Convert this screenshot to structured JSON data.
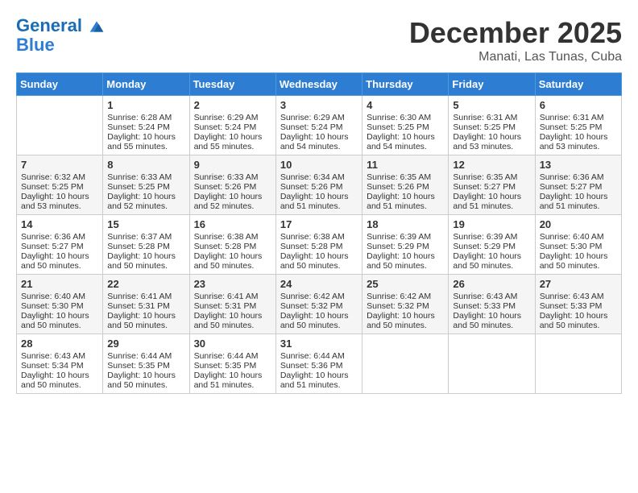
{
  "header": {
    "logo_line1": "General",
    "logo_line2": "Blue",
    "month_title": "December 2025",
    "location": "Manati, Las Tunas, Cuba"
  },
  "days_of_week": [
    "Sunday",
    "Monday",
    "Tuesday",
    "Wednesday",
    "Thursday",
    "Friday",
    "Saturday"
  ],
  "weeks": [
    [
      {
        "day": "",
        "content": ""
      },
      {
        "day": "1",
        "content": "Sunrise: 6:28 AM\nSunset: 5:24 PM\nDaylight: 10 hours\nand 55 minutes."
      },
      {
        "day": "2",
        "content": "Sunrise: 6:29 AM\nSunset: 5:24 PM\nDaylight: 10 hours\nand 55 minutes."
      },
      {
        "day": "3",
        "content": "Sunrise: 6:29 AM\nSunset: 5:24 PM\nDaylight: 10 hours\nand 54 minutes."
      },
      {
        "day": "4",
        "content": "Sunrise: 6:30 AM\nSunset: 5:25 PM\nDaylight: 10 hours\nand 54 minutes."
      },
      {
        "day": "5",
        "content": "Sunrise: 6:31 AM\nSunset: 5:25 PM\nDaylight: 10 hours\nand 53 minutes."
      },
      {
        "day": "6",
        "content": "Sunrise: 6:31 AM\nSunset: 5:25 PM\nDaylight: 10 hours\nand 53 minutes."
      }
    ],
    [
      {
        "day": "7",
        "content": "Sunrise: 6:32 AM\nSunset: 5:25 PM\nDaylight: 10 hours\nand 53 minutes."
      },
      {
        "day": "8",
        "content": "Sunrise: 6:33 AM\nSunset: 5:25 PM\nDaylight: 10 hours\nand 52 minutes."
      },
      {
        "day": "9",
        "content": "Sunrise: 6:33 AM\nSunset: 5:26 PM\nDaylight: 10 hours\nand 52 minutes."
      },
      {
        "day": "10",
        "content": "Sunrise: 6:34 AM\nSunset: 5:26 PM\nDaylight: 10 hours\nand 51 minutes."
      },
      {
        "day": "11",
        "content": "Sunrise: 6:35 AM\nSunset: 5:26 PM\nDaylight: 10 hours\nand 51 minutes."
      },
      {
        "day": "12",
        "content": "Sunrise: 6:35 AM\nSunset: 5:27 PM\nDaylight: 10 hours\nand 51 minutes."
      },
      {
        "day": "13",
        "content": "Sunrise: 6:36 AM\nSunset: 5:27 PM\nDaylight: 10 hours\nand 51 minutes."
      }
    ],
    [
      {
        "day": "14",
        "content": "Sunrise: 6:36 AM\nSunset: 5:27 PM\nDaylight: 10 hours\nand 50 minutes."
      },
      {
        "day": "15",
        "content": "Sunrise: 6:37 AM\nSunset: 5:28 PM\nDaylight: 10 hours\nand 50 minutes."
      },
      {
        "day": "16",
        "content": "Sunrise: 6:38 AM\nSunset: 5:28 PM\nDaylight: 10 hours\nand 50 minutes."
      },
      {
        "day": "17",
        "content": "Sunrise: 6:38 AM\nSunset: 5:28 PM\nDaylight: 10 hours\nand 50 minutes."
      },
      {
        "day": "18",
        "content": "Sunrise: 6:39 AM\nSunset: 5:29 PM\nDaylight: 10 hours\nand 50 minutes."
      },
      {
        "day": "19",
        "content": "Sunrise: 6:39 AM\nSunset: 5:29 PM\nDaylight: 10 hours\nand 50 minutes."
      },
      {
        "day": "20",
        "content": "Sunrise: 6:40 AM\nSunset: 5:30 PM\nDaylight: 10 hours\nand 50 minutes."
      }
    ],
    [
      {
        "day": "21",
        "content": "Sunrise: 6:40 AM\nSunset: 5:30 PM\nDaylight: 10 hours\nand 50 minutes."
      },
      {
        "day": "22",
        "content": "Sunrise: 6:41 AM\nSunset: 5:31 PM\nDaylight: 10 hours\nand 50 minutes."
      },
      {
        "day": "23",
        "content": "Sunrise: 6:41 AM\nSunset: 5:31 PM\nDaylight: 10 hours\nand 50 minutes."
      },
      {
        "day": "24",
        "content": "Sunrise: 6:42 AM\nSunset: 5:32 PM\nDaylight: 10 hours\nand 50 minutes."
      },
      {
        "day": "25",
        "content": "Sunrise: 6:42 AM\nSunset: 5:32 PM\nDaylight: 10 hours\nand 50 minutes."
      },
      {
        "day": "26",
        "content": "Sunrise: 6:43 AM\nSunset: 5:33 PM\nDaylight: 10 hours\nand 50 minutes."
      },
      {
        "day": "27",
        "content": "Sunrise: 6:43 AM\nSunset: 5:33 PM\nDaylight: 10 hours\nand 50 minutes."
      }
    ],
    [
      {
        "day": "28",
        "content": "Sunrise: 6:43 AM\nSunset: 5:34 PM\nDaylight: 10 hours\nand 50 minutes."
      },
      {
        "day": "29",
        "content": "Sunrise: 6:44 AM\nSunset: 5:35 PM\nDaylight: 10 hours\nand 50 minutes."
      },
      {
        "day": "30",
        "content": "Sunrise: 6:44 AM\nSunset: 5:35 PM\nDaylight: 10 hours\nand 51 minutes."
      },
      {
        "day": "31",
        "content": "Sunrise: 6:44 AM\nSunset: 5:36 PM\nDaylight: 10 hours\nand 51 minutes."
      },
      {
        "day": "",
        "content": ""
      },
      {
        "day": "",
        "content": ""
      },
      {
        "day": "",
        "content": ""
      }
    ]
  ]
}
